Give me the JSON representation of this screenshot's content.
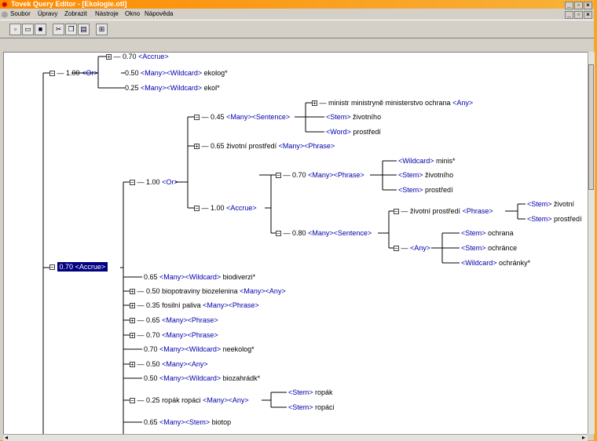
{
  "window": {
    "title": "Tovek Query Editor - [Ekologie.otl]",
    "title_buttons": [
      "_",
      "▫",
      "×"
    ],
    "doc_buttons": [
      "_",
      "▫",
      "×"
    ]
  },
  "menu": [
    "Soubor",
    "Úpravy",
    "Zobrazit",
    "Nástroje",
    "Okno",
    "Nápověda"
  ],
  "toolbar": {
    "buttons": [
      "new-icon",
      "open-icon",
      "save-icon",
      "cut-icon",
      "copy-icon",
      "paste-icon",
      "find-icon"
    ]
  },
  "tree": {
    "n1_w": "0.70",
    "n1_op": "<Accrue>",
    "n2_w": "1.00",
    "n2_op": "<Or>",
    "n3_w": "0.50",
    "n3_op": "<Many><Wildcard>",
    "n3_t": "ekolog*",
    "n4_w": "0.25",
    "n4_op": "<Many><Wildcard>",
    "n4_t": "ekol*",
    "n5_t": "ministr ministryně ministerstvo ochrana",
    "n5_op": "<Any>",
    "n6_w": "0.45",
    "n6_op": "<Many><Sentence>",
    "n7_op": "<Stem>",
    "n7_t": "životního",
    "n8_op": "<Word>",
    "n8_t": "prostředí",
    "n9_w": "0.65",
    "n9_t": "životní prostředí",
    "n9_op": "<Many><Phrase>",
    "n10_op": "<Wildcard>",
    "n10_t": "minis*",
    "n11_w": "1.00",
    "n11_op": "<Or>",
    "n12_w": "0.70",
    "n12_op": "<Many><Phrase>",
    "n13_op": "<Stem>",
    "n13_t": "životního",
    "n14_op": "<Stem>",
    "n14_t": "prostředí",
    "n15_op": "<Stem>",
    "n15_t": "životní",
    "n16_w": "1.00",
    "n16_op": "<Accrue>",
    "n17_t": "životní prostředí",
    "n17_op": "<Phrase>",
    "n18_op": "<Stem>",
    "n18_t": "prostředí",
    "n19_op": "<Stem>",
    "n19_t": "ochrana",
    "n20_w": "0.80",
    "n20_op": "<Many><Sentence>",
    "n21_op": "<Any>",
    "n22_op": "<Stem>",
    "n22_t": "ochránce",
    "n23_op": "<Wildcard>",
    "n23_t": "ochránky*",
    "root_w": "0.70",
    "root_op": "<Accrue>",
    "c1_w": "0.65",
    "c1_op": "<Many><Wildcard>",
    "c1_t": "biodiverzi*",
    "c2_w": "0.50",
    "c2_t": "biopotraviny biozelenina",
    "c2_op": "<Many><Any>",
    "c3_w": "0.35",
    "c3_t": "fosilní paliva",
    "c3_op": "<Many><Phrase>",
    "c4_w": "0.65",
    "c4_op": "<Many><Phrase>",
    "c5_w": "0.70",
    "c5_op": "<Many><Phrase>",
    "c6_w": "0.70",
    "c6_op": "<Many><Wildcard>",
    "c6_t": "neekolog*",
    "c7_w": "0.50",
    "c7_op": "<Many><Any>",
    "c8_w": "0.50",
    "c8_op": "<Many><Wildcard>",
    "c8_t": "biozahrádk*",
    "c9_w": "0.25",
    "c9_t": "ropák ropáci",
    "c9_op": "<Many><Any>",
    "c9a_op": "<Stem>",
    "c9a_t": "ropák",
    "c9b_op": "<Stem>",
    "c9b_t": "ropáci",
    "c10_w": "0.65",
    "c10_op": "<Many><Stem>",
    "c10_t": "biotop"
  }
}
